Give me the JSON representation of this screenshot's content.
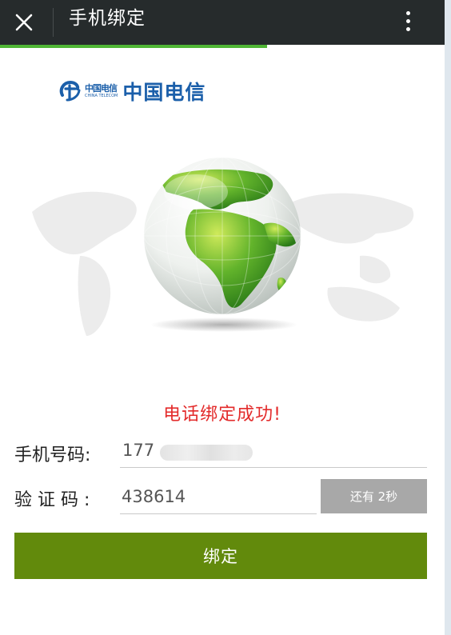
{
  "header": {
    "title": "手机绑定",
    "close_icon": "close-icon",
    "more_icon": "more-vertical-icon",
    "progress_percent": 60,
    "colors": {
      "bar": "#262b2c",
      "progress": "#4fb535"
    }
  },
  "brand": {
    "icon": "china-telecom-logo-icon",
    "mini_cn": "中国电信",
    "mini_en": "CHINA TELECOM",
    "name": "中国电信",
    "color": "#1b5faa"
  },
  "hero": {
    "icon": "globe-world-map-icon"
  },
  "form": {
    "success_message": "电话绑定成功!",
    "phone_label": "手机号码:",
    "phone_value": "177",
    "code_label": "验证码:",
    "code_value": "438614",
    "countdown_label": "还有 2秒",
    "submit_label": "绑定",
    "colors": {
      "success": "#e32b2b",
      "submit": "#628a0c",
      "countdown": "#a8a8a8"
    }
  }
}
